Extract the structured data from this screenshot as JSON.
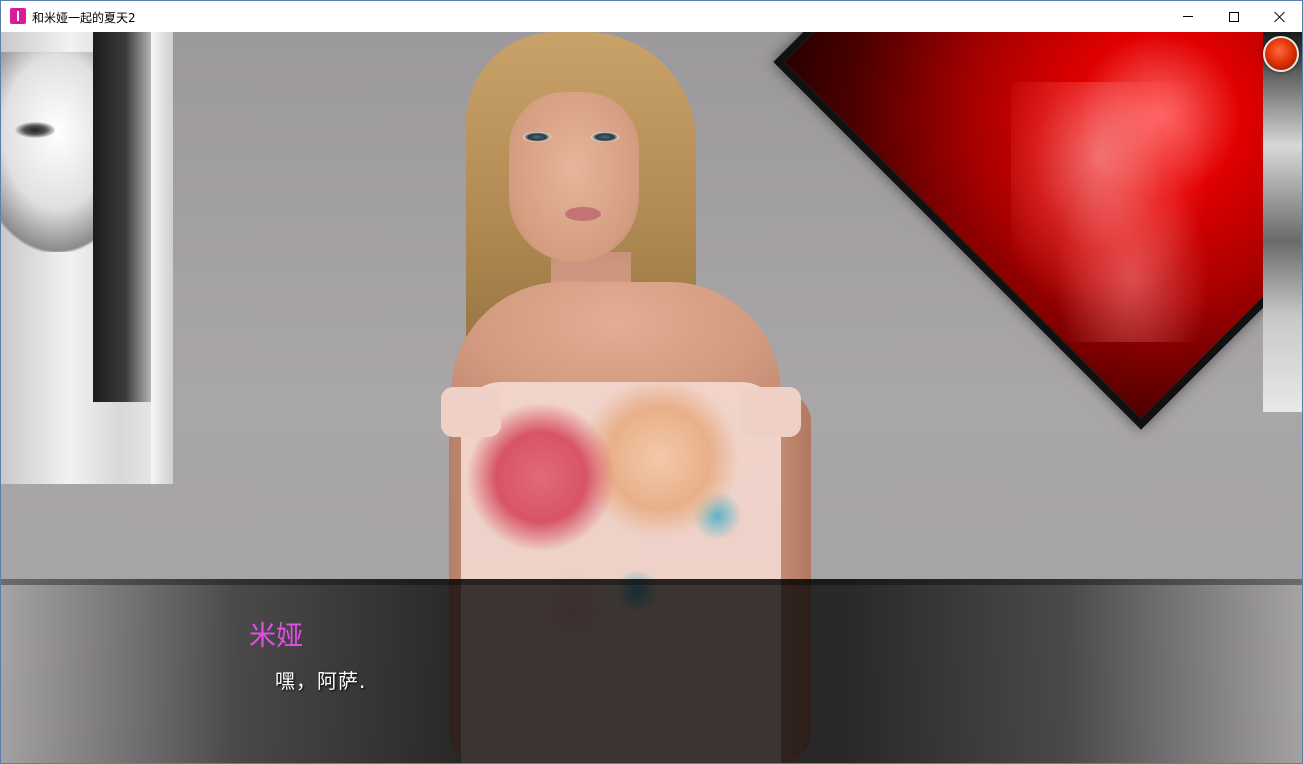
{
  "window": {
    "title": "和米娅一起的夏天2",
    "icon": "app-icon",
    "controls": {
      "minimize": "minimize-icon",
      "maximize": "maximize-icon",
      "close": "close-icon"
    }
  },
  "colors": {
    "speaker_name": "#e14ee8",
    "dialogue_text": "#ffffff",
    "quick_menu_button": "#d92b00",
    "app_icon": "#d81b9a"
  },
  "dialogue": {
    "speaker": "米娅",
    "text": "嘿，阿萨."
  }
}
